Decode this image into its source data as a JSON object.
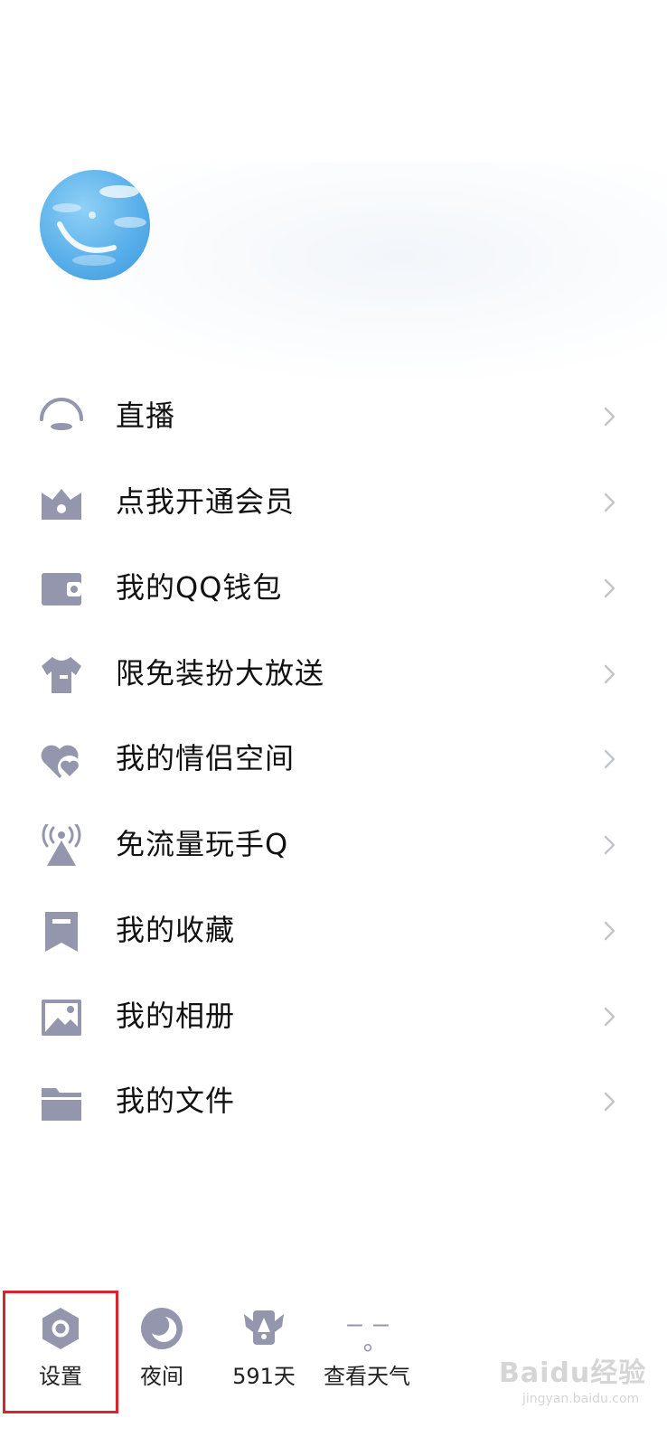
{
  "profile": {
    "avatar_icon": "sky-avatar-icon"
  },
  "menu": {
    "items": [
      {
        "label": "直播",
        "icon": "live-icon"
      },
      {
        "label": "点我开通会员",
        "icon": "vip-crown-icon"
      },
      {
        "label": "我的QQ钱包",
        "icon": "wallet-icon"
      },
      {
        "label": "限免装扮大放送",
        "icon": "tshirt-icon"
      },
      {
        "label": "我的情侣空间",
        "icon": "hearts-icon"
      },
      {
        "label": "免流量玩手Q",
        "icon": "signal-tower-icon"
      },
      {
        "label": "我的收藏",
        "icon": "bookmark-icon"
      },
      {
        "label": "我的相册",
        "icon": "photo-icon"
      },
      {
        "label": "我的文件",
        "icon": "folder-icon"
      }
    ],
    "chevron_icon": "chevron-right-icon"
  },
  "bottom_bar": {
    "settings": {
      "label": "设置",
      "icon": "settings-hexagon-icon"
    },
    "night": {
      "label": "夜间",
      "icon": "moon-icon"
    },
    "days": {
      "label": "591天",
      "icon": "winged-badge-icon"
    },
    "weather": {
      "label": "查看天气",
      "icon": "weather-icon",
      "temp_placeholder": "– –°"
    }
  },
  "watermark": {
    "main": "Baidu经验",
    "sub": "jingyan.baidu.com"
  },
  "colors": {
    "icon_gray": "#9396ad",
    "chevron_gray": "#c4c4cc",
    "highlight_red": "#d8242c",
    "avatar_blue": "#5ab0ea"
  }
}
